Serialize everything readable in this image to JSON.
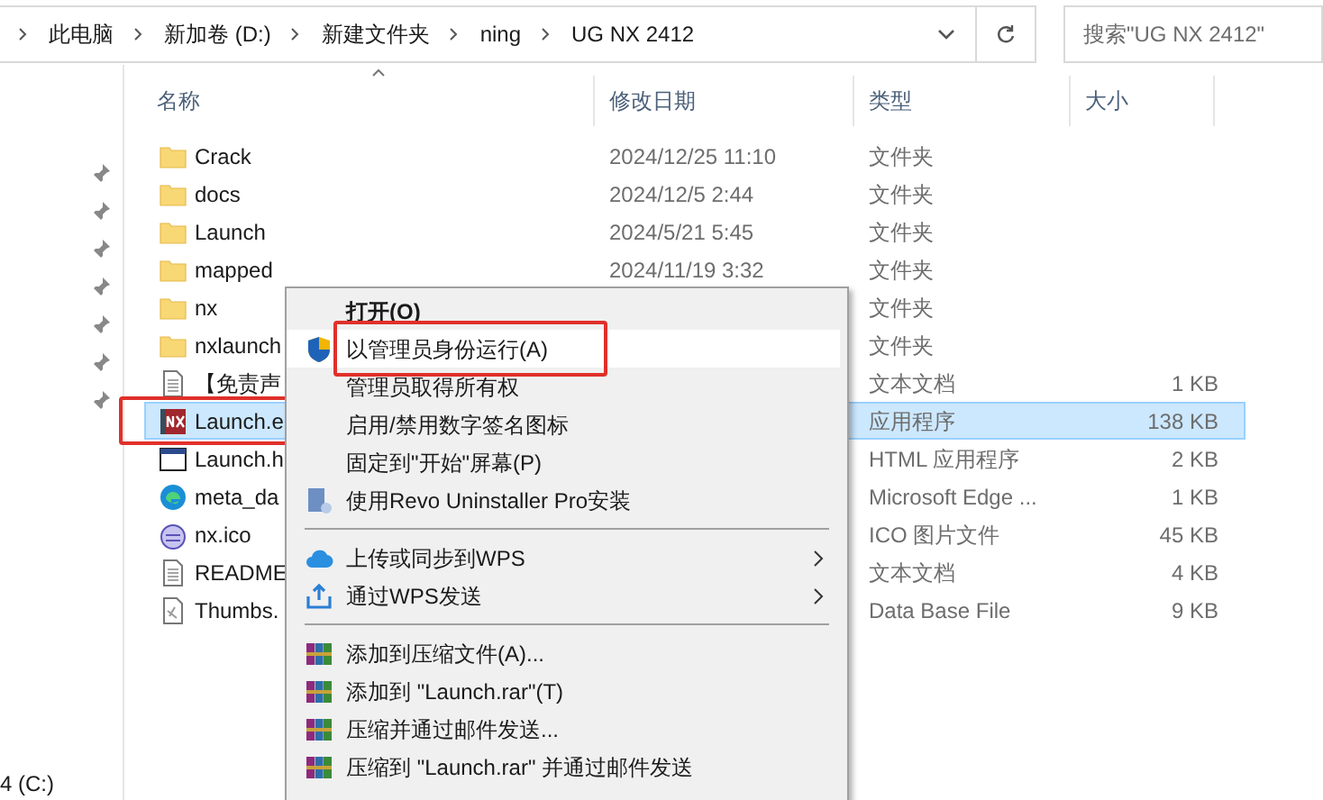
{
  "address_bar": {
    "crumbs": [
      "此电脑",
      "新加卷 (D:)",
      "新建文件夹",
      "ning",
      "UG NX 2412"
    ]
  },
  "search": {
    "placeholder": "搜索\"UG NX 2412\""
  },
  "columns": [
    "名称",
    "修改日期",
    "类型",
    "大小"
  ],
  "nav_pane": {
    "drive_label": "4 (C:)"
  },
  "files": [
    {
      "kind": "folder",
      "name": "Crack",
      "date": "2024/12/25 11:10",
      "type": "文件夹",
      "selected": false,
      "annotated": false
    },
    {
      "kind": "folder",
      "name": "docs",
      "date": "2024/12/5 2:44",
      "type": "文件夹",
      "selected": false,
      "annotated": false
    },
    {
      "kind": "folder",
      "name": "Launch",
      "date": "2024/5/21 5:45",
      "type": "文件夹",
      "selected": false,
      "annotated": false
    },
    {
      "kind": "folder",
      "name": "mapped",
      "date": "2024/11/19 3:32",
      "type": "文件夹",
      "selected": false,
      "annotated": false
    },
    {
      "kind": "folder",
      "name": "nx",
      "type": "文件夹",
      "selected": false,
      "annotated": false
    },
    {
      "kind": "folder",
      "name": "nxlaunch",
      "type": "文件夹",
      "selected": false,
      "annotated": false
    },
    {
      "kind": "text",
      "name": "【免责声",
      "type": "文本文档",
      "size": "1 KB",
      "selected": false,
      "annotated": false
    },
    {
      "kind": "nx",
      "name": "Launch.e",
      "type": "应用程序",
      "size": "138 KB",
      "selected": true,
      "annotated": true
    },
    {
      "kind": "html",
      "name": "Launch.h",
      "type": "HTML 应用程序",
      "size": "2 KB",
      "selected": false,
      "annotated": false
    },
    {
      "kind": "edge",
      "name": "meta_da",
      "type": "Microsoft Edge ...",
      "size": "1 KB",
      "selected": false,
      "annotated": false
    },
    {
      "kind": "ico",
      "name": "nx.ico",
      "type": "ICO 图片文件",
      "size": "45 KB",
      "selected": false,
      "annotated": false
    },
    {
      "kind": "text",
      "name": "README",
      "type": "文本文档",
      "size": "4 KB",
      "selected": false,
      "annotated": false
    },
    {
      "kind": "thumbs",
      "name": "Thumbs.",
      "type": "Data Base File",
      "size": "9 KB",
      "selected": false,
      "annotated": false
    }
  ],
  "context_menu": [
    {
      "kind": "plain",
      "label": "打开(O)",
      "default": true,
      "selected": false,
      "annotated": false
    },
    {
      "kind": "shield",
      "label": "以管理员身份运行(A)",
      "default": false,
      "selected": true,
      "annotated": true
    },
    {
      "kind": "plain",
      "label": "管理员取得所有权",
      "default": false,
      "selected": false,
      "annotated": false
    },
    {
      "kind": "plain",
      "label": "启用/禁用数字签名图标",
      "default": false,
      "selected": false,
      "annotated": false
    },
    {
      "kind": "plain",
      "label": "固定到\"开始\"屏幕(P)",
      "default": false,
      "selected": false,
      "annotated": false
    },
    {
      "kind": "revo",
      "label": "使用Revo Uninstaller Pro安装",
      "default": false,
      "selected": false,
      "annotated": false
    },
    {
      "kind": "separator"
    },
    {
      "kind": "cloud",
      "label": "上传或同步到WPS",
      "submenu": true,
      "default": false,
      "selected": false,
      "annotated": false
    },
    {
      "kind": "share",
      "label": "通过WPS发送",
      "submenu": true,
      "default": false,
      "selected": false,
      "annotated": false
    },
    {
      "kind": "separator"
    },
    {
      "kind": "archive",
      "label": "添加到压缩文件(A)...",
      "default": false,
      "selected": false,
      "annotated": false
    },
    {
      "kind": "archive",
      "label": "添加到 \"Launch.rar\"(T)",
      "default": false,
      "selected": false,
      "annotated": false
    },
    {
      "kind": "archive",
      "label": "压缩并通过邮件发送...",
      "default": false,
      "selected": false,
      "annotated": false
    },
    {
      "kind": "archive",
      "label": "压缩到 \"Launch.rar\" 并通过邮件发送",
      "default": false,
      "selected": false,
      "annotated": false
    }
  ]
}
